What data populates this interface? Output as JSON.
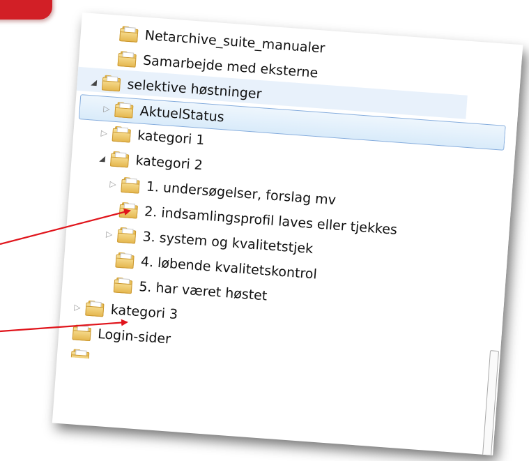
{
  "window": {
    "tree": [
      {
        "label": "Netarchive_suite_manualer",
        "twisty": "none",
        "level": 1
      },
      {
        "label": "Samarbejde med eksterne",
        "twisty": "none",
        "level": 1
      },
      {
        "label": "selektive høstninger",
        "twisty": "expanded",
        "level": 0
      },
      {
        "label": "AktuelStatus",
        "twisty": "collapsed",
        "level": 1
      },
      {
        "label": "kategori 1",
        "twisty": "collapsed",
        "level": 1
      },
      {
        "label": "kategori 2",
        "twisty": "expanded",
        "level": 1
      },
      {
        "label": "1. undersøgelser, forslag mv",
        "twisty": "collapsed",
        "level": 2
      },
      {
        "label": "2. indsamlingsprofil laves eller tjekkes",
        "twisty": "none",
        "level": 2
      },
      {
        "label": "3. system og kvalitetstjek",
        "twisty": "collapsed",
        "level": 2
      },
      {
        "label": "4. løbende kvalitetskontrol",
        "twisty": "none",
        "level": 2
      },
      {
        "label": "5. har været høstet",
        "twisty": "none",
        "level": 2
      },
      {
        "label": "kategori 3",
        "twisty": "collapsed",
        "level": 0
      },
      {
        "label": "Login-sider",
        "twisty": "none",
        "level": 0
      }
    ]
  },
  "icons": {
    "folder": "folder-icon",
    "expanded": "triangle-expanded-icon",
    "collapsed": "triangle-collapsed-icon"
  },
  "colors": {
    "selection_border": "#84acdd",
    "selection_fill": "#d9ebfa",
    "arrow": "#e0141b",
    "corner_accent": "#d21f26"
  }
}
